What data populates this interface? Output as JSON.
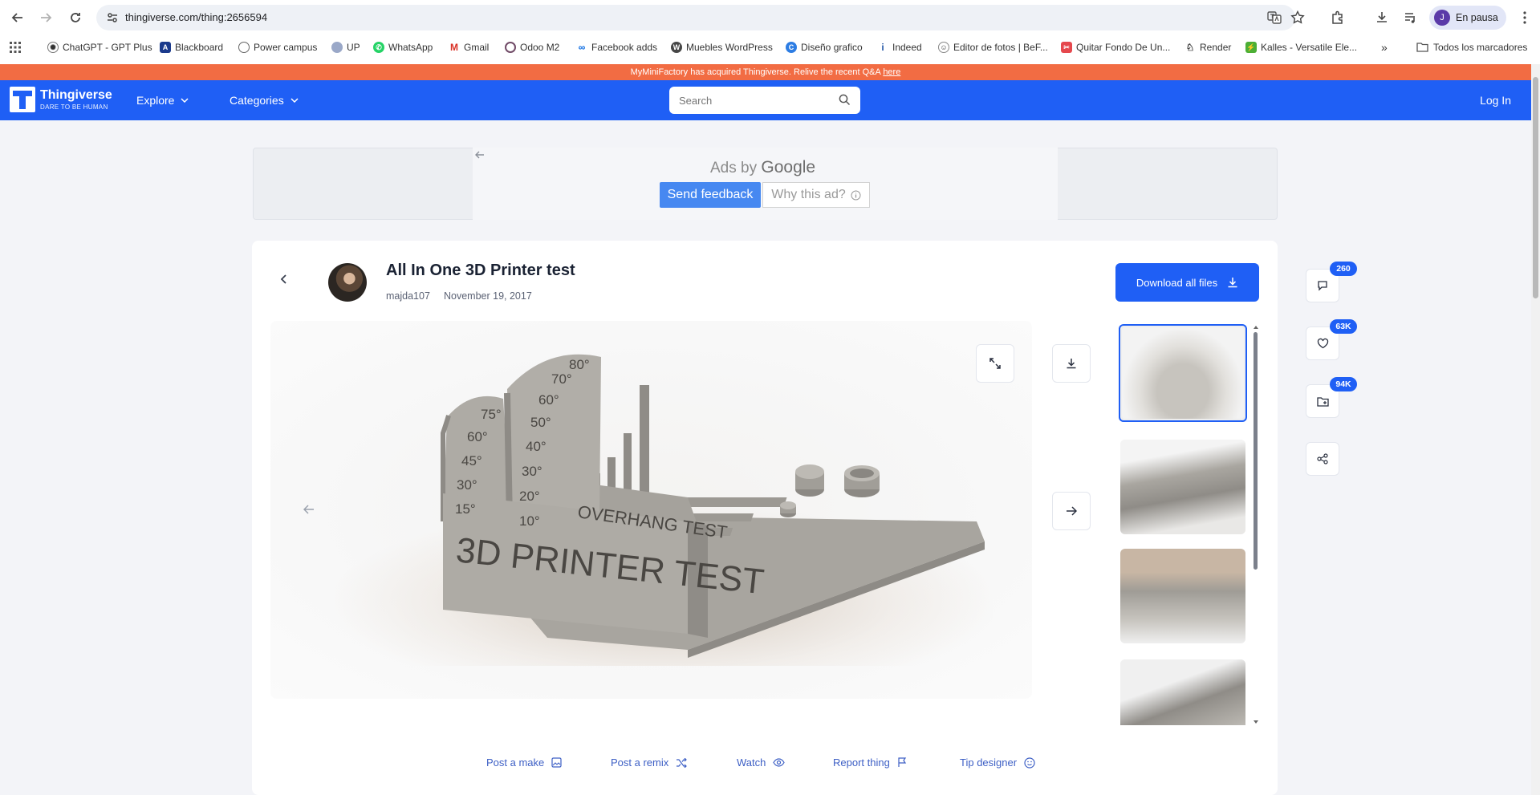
{
  "browser": {
    "url": "thingiverse.com/thing:2656594",
    "profile_initial": "J",
    "profile_status": "En pausa",
    "bookmarks": [
      {
        "label": "ChatGPT - GPT Plus",
        "icon": "chatgpt-icon"
      },
      {
        "label": "Blackboard",
        "icon": "blackboard-icon"
      },
      {
        "label": "Power campus",
        "icon": "globe-icon"
      },
      {
        "label": "UP",
        "icon": "up-icon"
      },
      {
        "label": "WhatsApp",
        "icon": "whatsapp-icon"
      },
      {
        "label": "Gmail",
        "icon": "gmail-icon"
      },
      {
        "label": "Odoo M2",
        "icon": "odoo-icon"
      },
      {
        "label": "Facebook adds",
        "icon": "meta-icon"
      },
      {
        "label": "Muebles WordPress",
        "icon": "wordpress-icon"
      },
      {
        "label": "Diseño grafico",
        "icon": "canva-icon"
      },
      {
        "label": "Indeed",
        "icon": "indeed-icon"
      },
      {
        "label": "Editor de fotos | BeF...",
        "icon": "befunky-icon"
      },
      {
        "label": "Quitar Fondo De Un...",
        "icon": "remove-bg-icon"
      },
      {
        "label": "Render",
        "icon": "render-icon"
      },
      {
        "label": "Kalles - Versatile Ele...",
        "icon": "kalles-icon"
      }
    ],
    "all_bookmarks": "Todos los marcadores"
  },
  "site": {
    "announcement": "MyMiniFactory has acquired Thingiverse. Relive the recent Q&A",
    "announcement_link": "here",
    "logo_name": "Thingiverse",
    "logo_tagline": "DARE TO BE HUMAN",
    "nav": {
      "explore": "Explore",
      "categories": "Categories"
    },
    "search_placeholder": "Search",
    "login": "Log In"
  },
  "ad": {
    "ads_by": "Ads by",
    "google": "Google",
    "send_feedback": "Send feedback",
    "why_this_ad": "Why this ad?"
  },
  "thing": {
    "title": "All In One 3D Printer test",
    "author": "majda107",
    "date": "November 19, 2017",
    "download_all": "Download all files",
    "render": {
      "big_text": "3D PRINTER TEST",
      "overhang_text": "OVERHANG TEST",
      "arc1": [
        "15°",
        "30°",
        "45°",
        "60°",
        "75°"
      ],
      "arc2": [
        "10°",
        "20°",
        "30°",
        "40°",
        "50°",
        "60°",
        "70°",
        "80°"
      ]
    },
    "thumbnails": 4,
    "stats": {
      "comments": "260",
      "likes": "63K",
      "collections": "94K"
    },
    "actions": {
      "post_make": "Post a make",
      "post_remix": "Post a remix",
      "watch": "Watch",
      "report": "Report thing",
      "tip": "Tip designer"
    }
  },
  "colors": {
    "brand": "#1f5ff5",
    "announce": "#f26c43"
  }
}
